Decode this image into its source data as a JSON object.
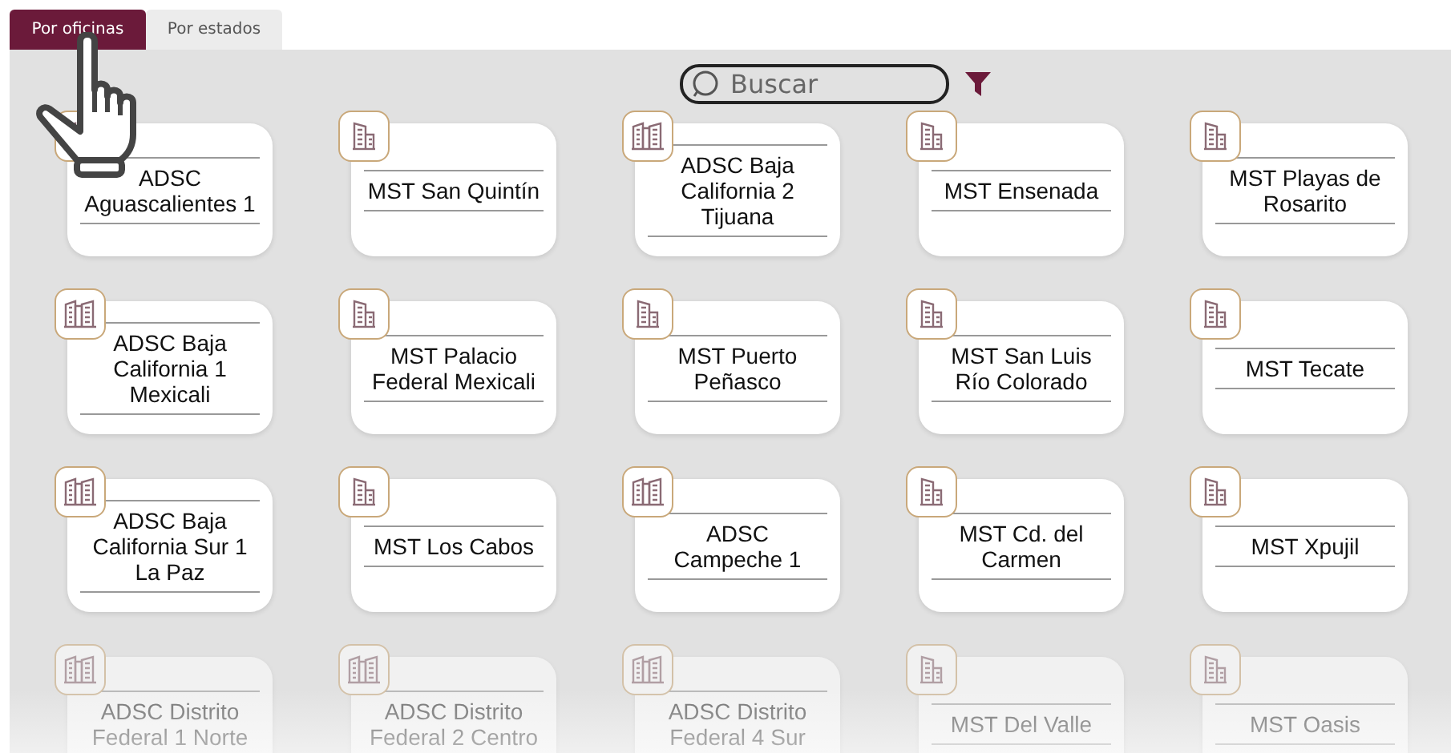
{
  "tabs": [
    {
      "label": "Por oficinas",
      "selected": true
    },
    {
      "label": "Por estados",
      "selected": false
    }
  ],
  "search": {
    "placeholder": "Buscar"
  },
  "offices": [
    {
      "name": "ADSC Aguascalientes 1",
      "kind": "adsc"
    },
    {
      "name": "MST San Quintín",
      "kind": "mst"
    },
    {
      "name": "ADSC Baja California 2 Tijuana",
      "kind": "adsc"
    },
    {
      "name": "MST Ensenada",
      "kind": "mst"
    },
    {
      "name": "MST Playas de Rosarito",
      "kind": "mst"
    },
    {
      "name": "ADSC Baja California 1 Mexicali",
      "kind": "adsc"
    },
    {
      "name": "MST Palacio Federal Mexicali",
      "kind": "mst"
    },
    {
      "name": "MST Puerto Peñasco",
      "kind": "mst"
    },
    {
      "name": "MST San Luis Río Colorado",
      "kind": "mst"
    },
    {
      "name": "MST Tecate",
      "kind": "mst"
    },
    {
      "name": "ADSC Baja California Sur 1 La Paz",
      "kind": "adsc"
    },
    {
      "name": "MST Los Cabos",
      "kind": "mst"
    },
    {
      "name": "ADSC Campeche 1",
      "kind": "adsc"
    },
    {
      "name": "MST Cd. del Carmen",
      "kind": "mst"
    },
    {
      "name": "MST Xpujil",
      "kind": "mst"
    },
    {
      "name": "ADSC Distrito Federal 1 Norte",
      "kind": "adsc"
    },
    {
      "name": "ADSC Distrito Federal 2 Centro",
      "kind": "adsc"
    },
    {
      "name": "ADSC Distrito Federal 4 Sur",
      "kind": "adsc"
    },
    {
      "name": "MST Del Valle",
      "kind": "mst"
    },
    {
      "name": "MST Oasis",
      "kind": "mst"
    }
  ]
}
